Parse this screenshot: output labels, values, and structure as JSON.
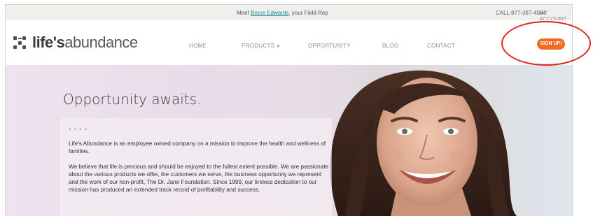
{
  "topbar": {
    "rep_prefix": "Meet ",
    "rep_name": "Bruce Edwards",
    "rep_suffix": ", your Field Rep",
    "phone": "CALL 877-387-4564",
    "account": "MY ACCOUNT"
  },
  "logo": {
    "bold": "life's",
    "light": "abundance"
  },
  "nav": {
    "home": "HOME",
    "products": "PRODUCTS",
    "opportunity": "OPPORTUNITY",
    "blog": "BLOG",
    "contact": "CONTACT",
    "signup": "SIGN UP!"
  },
  "hero": {
    "title": "Opportunity awaits.",
    "dots": "• • • •",
    "paragraph1": "Life's Abundance is an employee owned company on a mission to improve the health and wellness of families.",
    "paragraph2": "We believe that life is precious and should be enjoyed to the fullest extent possible. We are passionate about the various products we offer, the customers we serve, the business opportunity we represent and the work of our non-profit, The Dr. Jane Foundation. Since 1999, our tireless dedication to our mission has produced an extended track record of profitability and success."
  },
  "colors": {
    "accent": "#f36b21",
    "annotation_ring": "#e2231a",
    "link": "#1a8a9c"
  }
}
